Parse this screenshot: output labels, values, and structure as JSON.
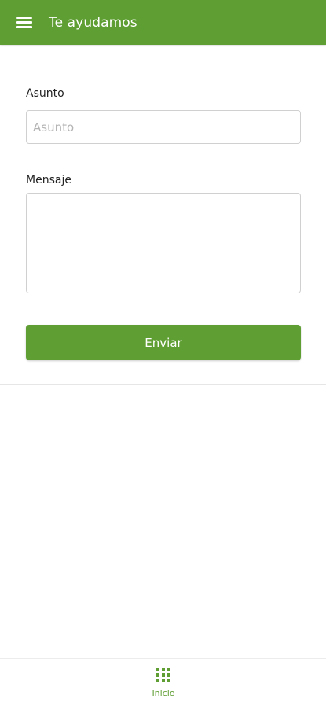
{
  "colors": {
    "primary": "#5f9e33",
    "white": "#ffffff"
  },
  "header": {
    "menu_icon": "hamburger-menu-icon",
    "title": "Te ayudamos"
  },
  "form": {
    "subject_label": "Asunto",
    "subject_placeholder": "Asunto",
    "subject_value": "",
    "message_label": "Mensaje",
    "message_value": "",
    "submit_label": "Enviar"
  },
  "bottom_nav": {
    "items": [
      {
        "icon": "grid-icon",
        "label": "Inicio"
      }
    ]
  }
}
